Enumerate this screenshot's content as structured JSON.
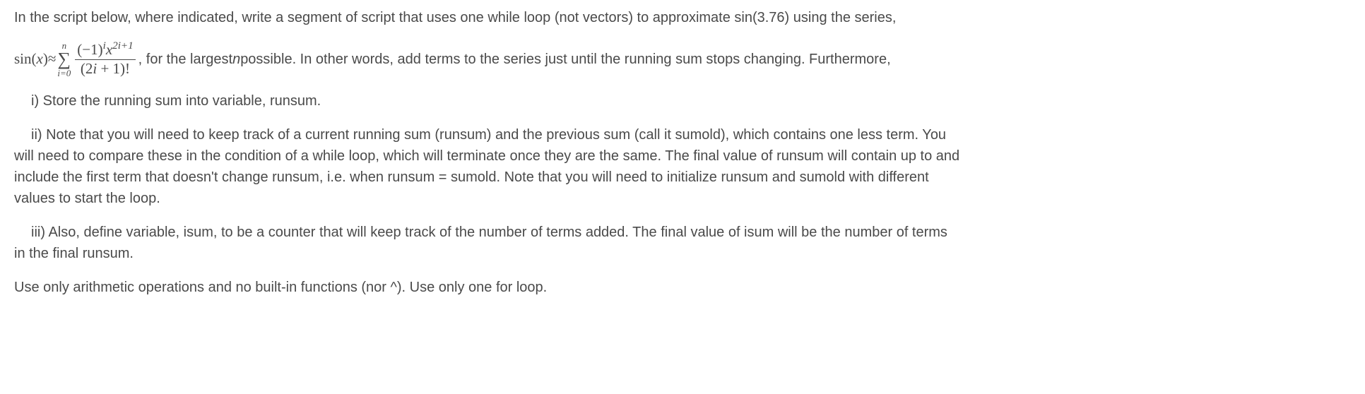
{
  "intro": {
    "part1": "In the script below, where indicated, write a segment of script that uses one while loop (not vectors) to approximate sin(3.76) using the series,",
    "part2": ", for the largest ",
    "nvar": "n",
    "part3": " possible. In other words, add terms to the series just until the running sum stops changing. Furthermore,"
  },
  "formula": {
    "lhs_sin": "sin",
    "lhs_open": " (",
    "lhs_x": "x",
    "lhs_close": ") ",
    "approx": "≈ ",
    "sigma_top": "n",
    "sigma_sym": "∑",
    "sigma_bot": "i=0",
    "num_open": "(−1)",
    "num_sup_i": "i",
    "num_x": "x",
    "num_sup_exp": "2i+1",
    "den_open": "(2",
    "den_i": "i",
    "den_close": " + 1)!"
  },
  "item_i": "i) Store the running sum into variable, runsum.",
  "item_ii_a": "ii) Note that you will need to keep track of a current running sum (runsum) and the previous sum (call it sumold), which contains one less term. You",
  "item_ii_b": "will need to compare these in the condition of a while loop, which will terminate once they are the same. The final value of runsum will contain up to and",
  "item_ii_c": "include the first term that doesn't change runsum, i.e. when runsum = sumold. Note that you will need to initialize runsum and sumold with different",
  "item_ii_d": "values to start the loop.",
  "item_iii_a": "iii) Also, define variable, isum, to be a counter that will keep track of the number of terms added. The final value of isum will be the number of terms",
  "item_iii_b": "in the final runsum.",
  "closing": "Use only arithmetic operations and no built-in functions (nor ^). Use only one for loop."
}
